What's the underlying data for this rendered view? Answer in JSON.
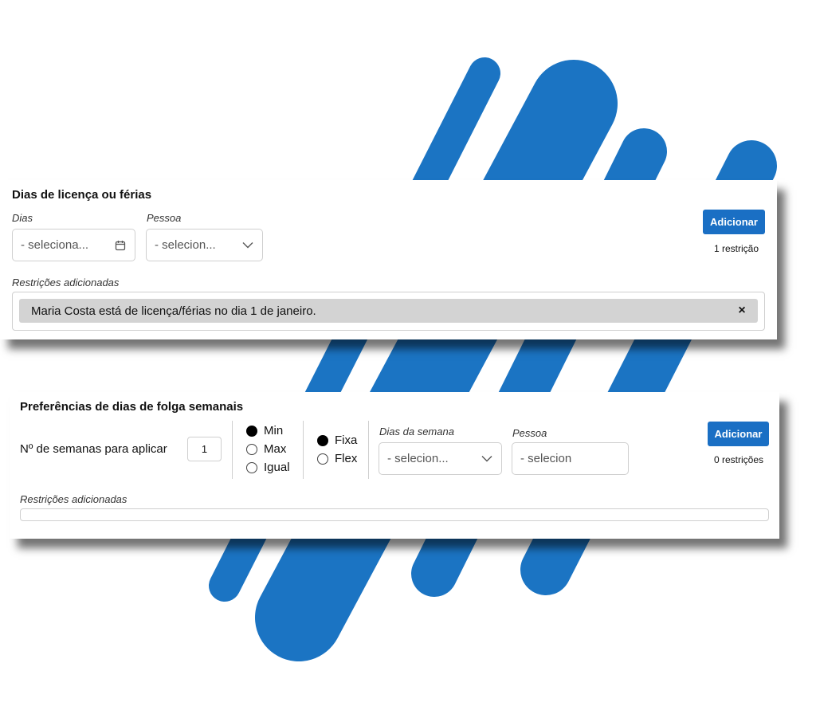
{
  "leave_panel": {
    "title": "Dias de licença ou férias",
    "days_label": "Dias",
    "days_value": "- seleciona...",
    "person_label": "Pessoa",
    "person_value": "- selecion...",
    "add_label": "Adicionar",
    "count_label": "1 restrição",
    "added_label": "Restrições adicionadas",
    "restrictions": [
      {
        "text": "Maria Costa está de licença/férias no dia 1 de janeiro.",
        "remove": "×"
      }
    ]
  },
  "dayoff_panel": {
    "title": "Preferências de dias de folga semanais",
    "weeks_label": "Nº de semanas para aplicar",
    "weeks_value": "1",
    "mode_options": [
      {
        "label": "Min",
        "selected": true
      },
      {
        "label": "Max",
        "selected": false
      },
      {
        "label": "Igual",
        "selected": false
      }
    ],
    "type_options": [
      {
        "label": "Fixa",
        "selected": true
      },
      {
        "label": "Flex",
        "selected": false
      }
    ],
    "weekdays_label": "Dias da semana",
    "weekdays_value": "- selecion...",
    "person_label": "Pessoa",
    "person_value": "- selecion",
    "add_label": "Adicionar",
    "count_label": "0 restrições",
    "added_label": "Restrições adicionadas"
  },
  "colors": {
    "accent": "#1a6fc4",
    "stripe": "#1b74c3",
    "chip": "#d3d3d3"
  }
}
